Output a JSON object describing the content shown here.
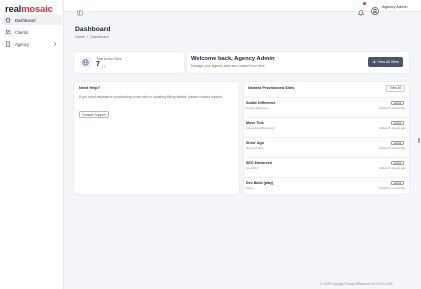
{
  "brand": {
    "logo_part1": "real",
    "logo_part2": "mosaic",
    "accent": "#e0323c"
  },
  "sidebar": {
    "items": [
      {
        "label": "Dashboard",
        "icon": "home-icon",
        "active": true
      },
      {
        "label": "Clients",
        "icon": "users-icon",
        "active": false
      },
      {
        "label": "Agency",
        "icon": "building-icon",
        "active": false,
        "expandable": true
      }
    ]
  },
  "topbar": {
    "user_name": "Agency Admin",
    "icons": [
      "collapse-sidebar-icon",
      "bell-icon",
      "user-avatar-icon"
    ]
  },
  "page": {
    "title": "Dashboard",
    "breadcrumb": [
      "Home",
      "/",
      "Dashboard"
    ]
  },
  "stats": {
    "label": "Total Active Sites",
    "value": "7",
    "sub": "/ 7"
  },
  "welcome": {
    "title": "Welcome back, Agency Admin",
    "subtitle": "Manage your agency sites and content from here",
    "button_label": "View All Sites"
  },
  "help": {
    "title": "Need Help?",
    "text": "If you need assistance provisioning a new site or updating billing details, please contact support.",
    "button_label": "Contact Support"
  },
  "sites": {
    "title": "Newest Provisioned Sites",
    "view_all": "View All",
    "items": [
      {
        "name": "Subtle Difference",
        "slug": "subtle-difference",
        "status": "active",
        "time": "Added 3 weeks ago"
      },
      {
        "name": "Move This",
        "slug": "move-thisdifference2",
        "status": "active",
        "time": "Added 3 weeks ago"
      },
      {
        "name": "Shiro' Ago",
        "slug": "shiroslondon",
        "status": "active",
        "time": "Added 3 weeks ago"
      },
      {
        "name": "SEO Enhanced",
        "slug": "seo2024",
        "status": "active",
        "time": "Added 3 weeks ago"
      },
      {
        "name": "Dev Build (play)",
        "slug": "dev-1",
        "status": "active",
        "time": "Added 1 month ago"
      }
    ]
  },
  "footer": {
    "text": "© 2025 Copyright Today Difference Ltd v1.0.0-1234"
  }
}
